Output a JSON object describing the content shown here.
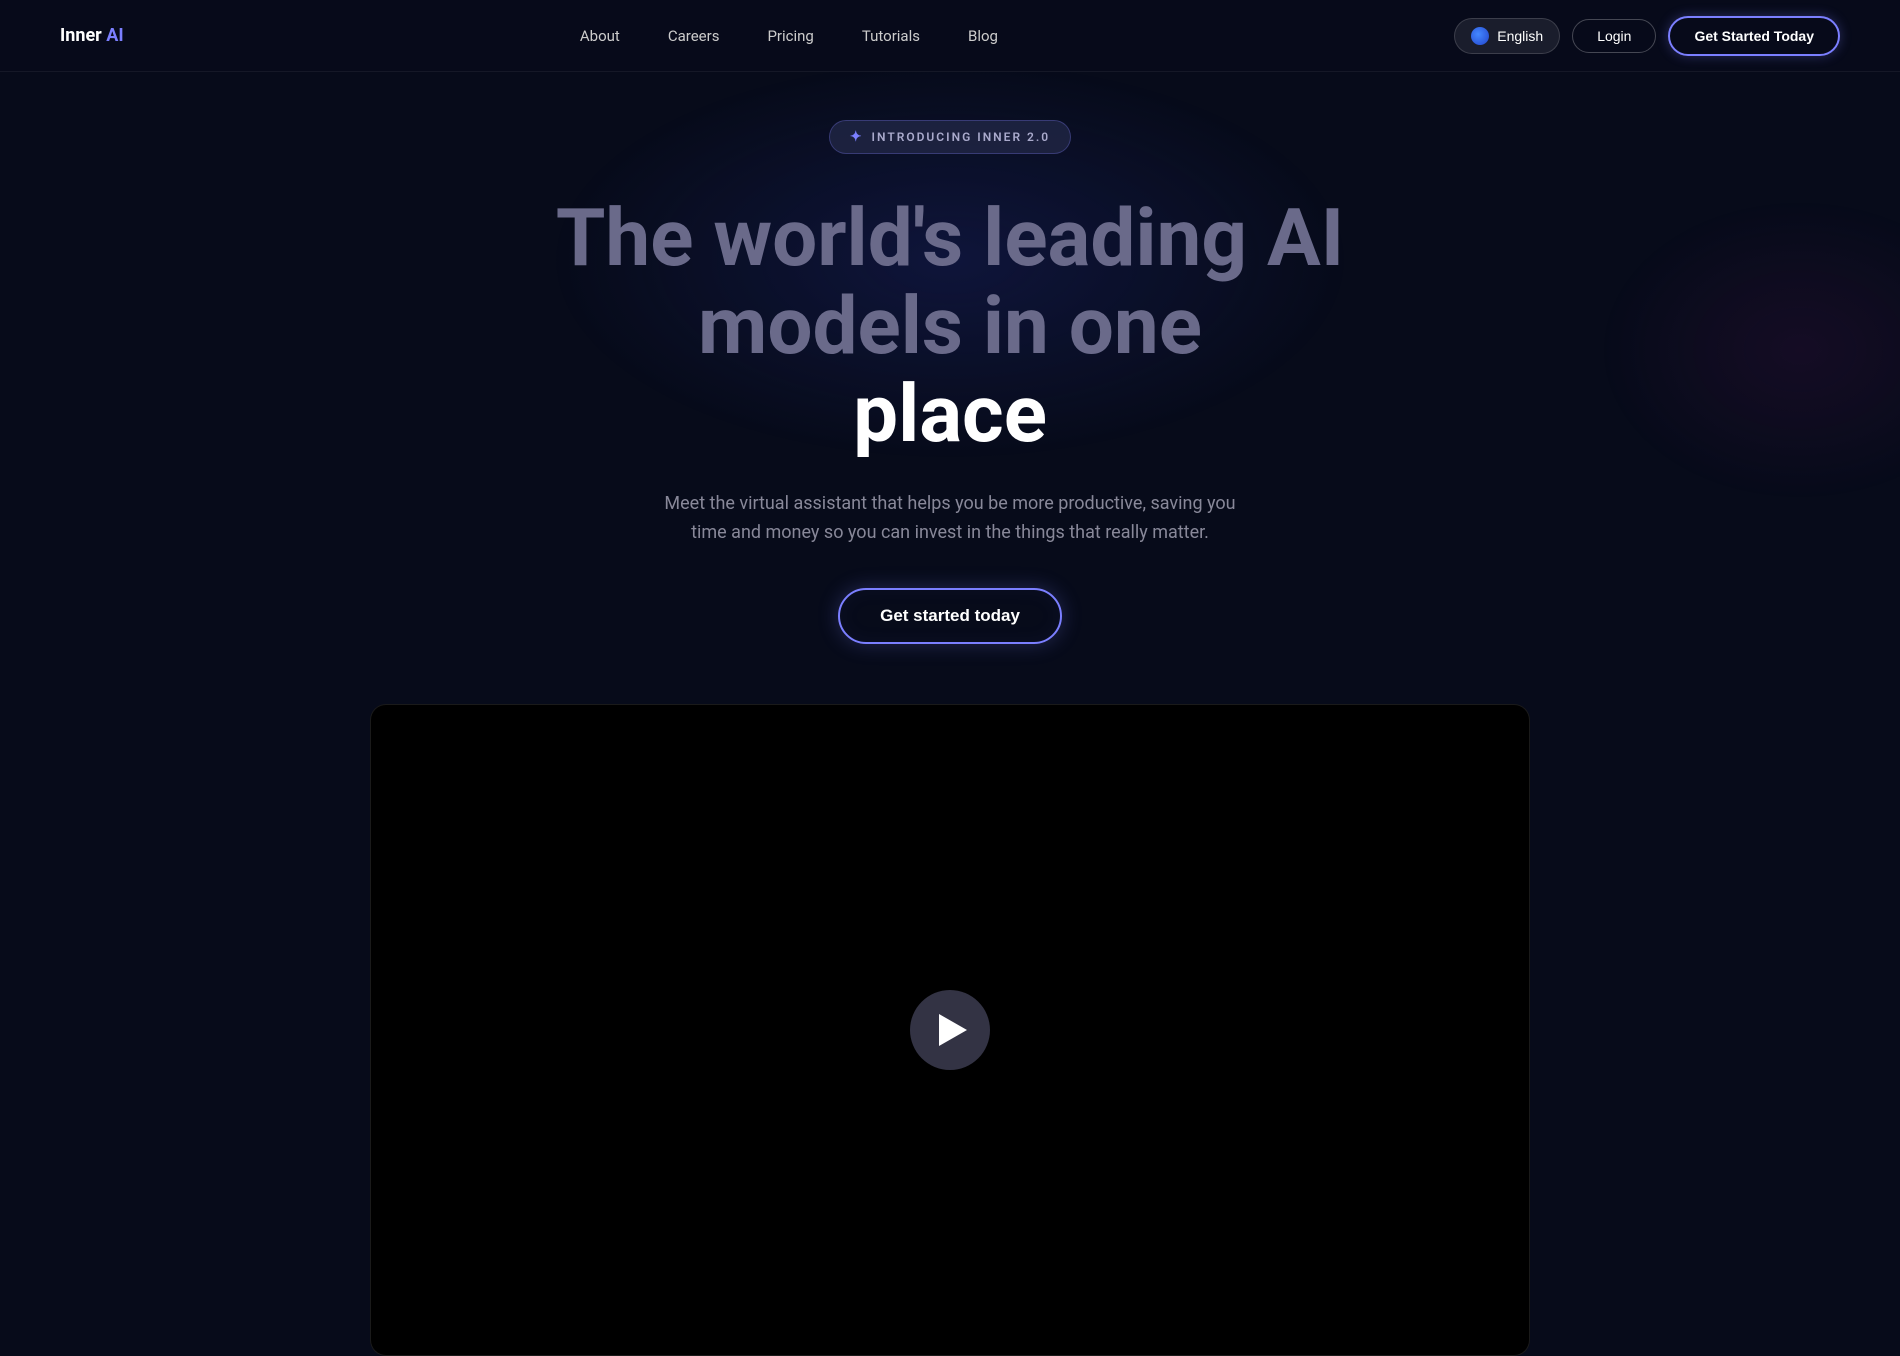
{
  "navbar": {
    "logo": "Inner AI",
    "nav_items": [
      {
        "label": "About",
        "href": "#about"
      },
      {
        "label": "Careers",
        "href": "#careers"
      },
      {
        "label": "Pricing",
        "href": "#pricing"
      },
      {
        "label": "Tutorials",
        "href": "#tutorials"
      },
      {
        "label": "Blog",
        "href": "#blog"
      }
    ],
    "lang_label": "English",
    "login_label": "Login",
    "get_started_label": "Get Started Today"
  },
  "hero": {
    "badge_text": "INTRODUCING INNER 2.0",
    "title_line1": "The world's leading AI models in one",
    "title_line2": "place",
    "subtitle": "Meet the virtual assistant that helps you be more productive, saving you time and money so you can invest in the things that really matter.",
    "cta_label": "Get started today"
  },
  "video": {
    "play_label": "Play video"
  }
}
